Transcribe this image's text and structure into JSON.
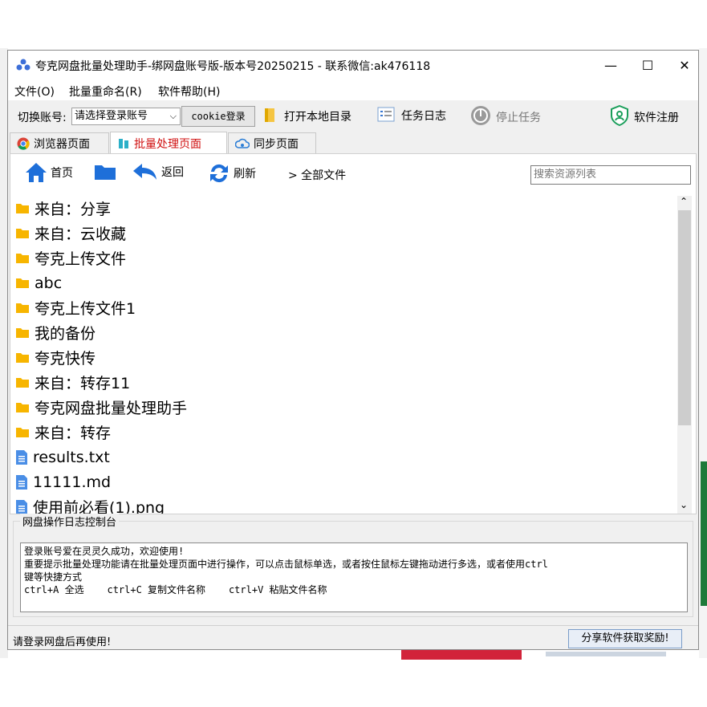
{
  "window": {
    "title": "夸克网盘批量处理助手-绑网盘账号版-版本号20250215 - 联系微信:ak476118",
    "controls": {
      "minimize": "—",
      "maximize": "☐",
      "close": "✕"
    }
  },
  "menu": [
    "文件(O)",
    "批量重命名(R)",
    "软件帮助(H)"
  ],
  "toolbar": {
    "switch_account_label": "切换账号:",
    "account_select_value": "请选择登录账号",
    "cookie_login": "cookie登录",
    "open_local_dir": "打开本地目录",
    "task_log": "任务日志",
    "stop_task": "停止任务",
    "register": "软件注册"
  },
  "tabs": [
    {
      "label": "浏览器页面",
      "active": false
    },
    {
      "label": "批量处理页面",
      "active": true
    },
    {
      "label": "同步页面",
      "active": false
    }
  ],
  "nav": {
    "home": "首页",
    "back": "返回",
    "refresh": "刷新",
    "breadcrumb": "> 全部文件",
    "search_placeholder": "搜索资源列表"
  },
  "files": [
    {
      "name": "来自：分享",
      "type": "folder"
    },
    {
      "name": "来自：云收藏",
      "type": "folder"
    },
    {
      "name": "夸克上传文件",
      "type": "folder"
    },
    {
      "name": "abc",
      "type": "folder"
    },
    {
      "name": "夸克上传文件1",
      "type": "folder"
    },
    {
      "name": "我的备份",
      "type": "folder"
    },
    {
      "name": "夸克快传",
      "type": "folder"
    },
    {
      "name": "来自：转存11",
      "type": "folder"
    },
    {
      "name": "夸克网盘批量处理助手",
      "type": "folder"
    },
    {
      "name": "来自：转存",
      "type": "folder"
    },
    {
      "name": "results.txt",
      "type": "file"
    },
    {
      "name": "11111.md",
      "type": "file"
    },
    {
      "name": "使用前必看(1).png",
      "type": "file"
    }
  ],
  "log": {
    "title": "网盘操作日志控制台",
    "lines": [
      "登录账号爱在灵灵久成功，欢迎使用!",
      "重要提示批量处理功能请在批量处理页面中进行操作，可以点击鼠标单选，或者按住鼠标左键拖动进行多选，或者使用ctrl",
      "键等快捷方式",
      "ctrl+A 全选    ctrl+C 复制文件名称    ctrl+V 粘贴文件名称"
    ]
  },
  "status": {
    "message": "请登录网盘后再使用!",
    "share_button": "分享软件获取奖励!"
  },
  "colors": {
    "folder": "#f7b500",
    "file": "#4a8ee6",
    "nav_icon": "#1e6fd9",
    "active_tab_text": "#d01010"
  }
}
